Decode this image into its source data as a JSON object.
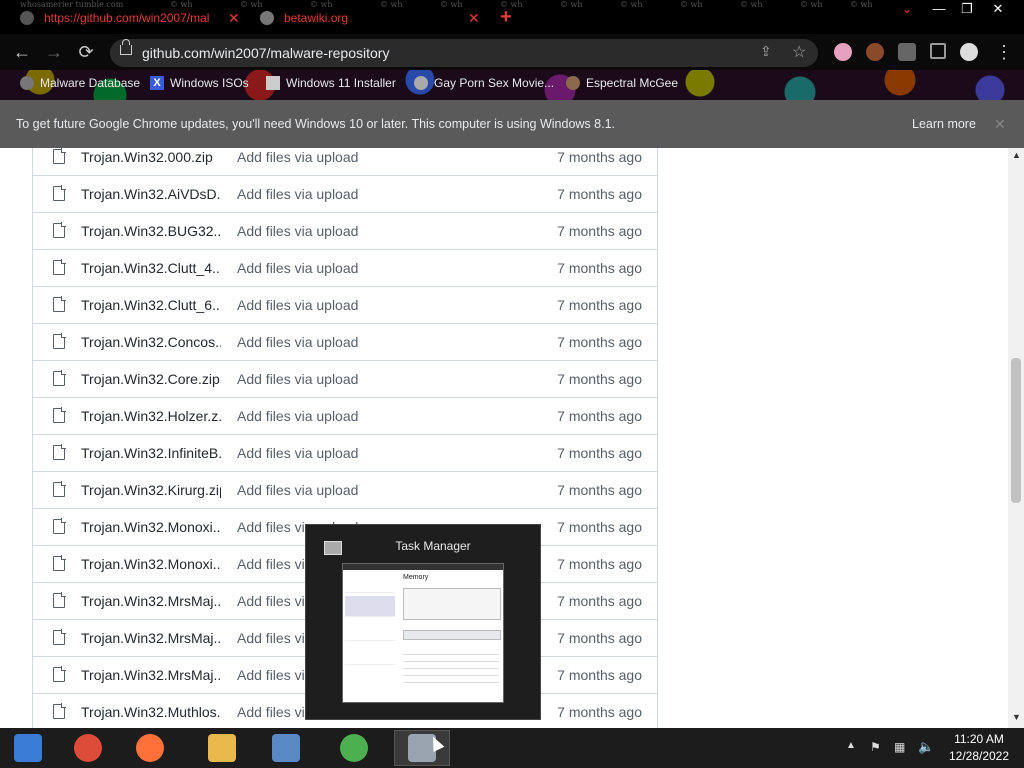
{
  "titlebar": {
    "watermark": "whosamerier tumble.com",
    "watermark_repeat": [
      "© wh",
      "© wh",
      "© wh",
      "© wh",
      "© wh",
      "© wh",
      "© wh",
      "© wh",
      "© wh",
      "© wh",
      "© wh",
      "© wh"
    ],
    "tabs": [
      {
        "title": "https://github.com/win2007/mal",
        "close": "✕"
      },
      {
        "title": "betawiki.org",
        "close": "✕"
      }
    ],
    "new_tab": "+",
    "tab_search": "⌄",
    "minimize": "—",
    "maximize": "❐",
    "close": "✕"
  },
  "toolbar": {
    "back": "←",
    "forward": "→",
    "reload": "⟳",
    "url": "github.com/win2007/malware-repository",
    "menu": "⋮"
  },
  "bookmarks": [
    {
      "label": "Malware Database",
      "icon": "malware-database-icon"
    },
    {
      "label": "Windows ISOs",
      "icon": "x-icon"
    },
    {
      "label": "Windows 11 Installer",
      "icon": "installer-icon"
    },
    {
      "label": "Gay Porn Sex Movie...",
      "icon": "site-icon"
    },
    {
      "label": "Espectral McGee",
      "icon": "site-icon"
    }
  ],
  "infobar": {
    "text": "To get future Google Chrome updates, you'll need Windows 10 or later. This computer is using Windows 8.1.",
    "learn_more": "Learn more",
    "close": "✕"
  },
  "files": [
    {
      "name": "Trojan.Win32.000.zip",
      "message": "Add files via upload",
      "age": "7 months ago"
    },
    {
      "name": "Trojan.Win32.AiVDsD...",
      "message": "Add files via upload",
      "age": "7 months ago"
    },
    {
      "name": "Trojan.Win32.BUG32....",
      "message": "Add files via upload",
      "age": "7 months ago"
    },
    {
      "name": "Trojan.Win32.Clutt_4....",
      "message": "Add files via upload",
      "age": "7 months ago"
    },
    {
      "name": "Trojan.Win32.Clutt_6....",
      "message": "Add files via upload",
      "age": "7 months ago"
    },
    {
      "name": "Trojan.Win32.Concos...",
      "message": "Add files via upload",
      "age": "7 months ago"
    },
    {
      "name": "Trojan.Win32.Core.zip",
      "message": "Add files via upload",
      "age": "7 months ago"
    },
    {
      "name": "Trojan.Win32.Holzer.z...",
      "message": "Add files via upload",
      "age": "7 months ago"
    },
    {
      "name": "Trojan.Win32.InfiniteB...",
      "message": "Add files via upload",
      "age": "7 months ago"
    },
    {
      "name": "Trojan.Win32.Kirurg.zip",
      "message": "Add files via upload",
      "age": "7 months ago"
    },
    {
      "name": "Trojan.Win32.Monoxi...",
      "message": "Add files via upload",
      "age": "7 months ago"
    },
    {
      "name": "Trojan.Win32.Monoxi...",
      "message": "Add files via upload",
      "age": "7 months ago"
    },
    {
      "name": "Trojan.Win32.MrsMaj...",
      "message": "Add files via upload",
      "age": "7 months ago"
    },
    {
      "name": "Trojan.Win32.MrsMaj...",
      "message": "Add files via upload",
      "age": "7 months ago"
    },
    {
      "name": "Trojan.Win32.MrsMaj...",
      "message": "Add files via upload",
      "age": "7 months ago"
    },
    {
      "name": "Trojan.Win32.Muthlos...",
      "message": "Add files via upload",
      "age": "7 months ago"
    }
  ],
  "thumbnail": {
    "title": "Task Manager",
    "preview_heading": "Memory"
  },
  "taskbar": {
    "apps": [
      {
        "name": "start",
        "color": "#3a7bd5"
      },
      {
        "name": "chrome",
        "color": "#dd4b39"
      },
      {
        "name": "firefox",
        "color": "#ff7139"
      },
      {
        "name": "file-explorer",
        "color": "#e8b84a"
      },
      {
        "name": "photos",
        "color": "#5a8ac6"
      },
      {
        "name": "users",
        "color": "#4caf50"
      },
      {
        "name": "task-manager",
        "color": "#9aa4b0"
      }
    ],
    "tray_arrow": "▲",
    "flag": "⚑",
    "network": "▦",
    "volume": "🔈",
    "time": "11:20 AM",
    "date": "12/28/2022"
  }
}
